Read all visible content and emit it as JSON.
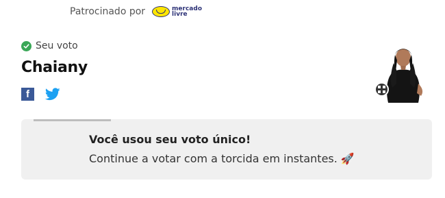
{
  "sponsor": {
    "label": "Patrocinado por",
    "brand_line1": "mercado",
    "brand_line2": "livre"
  },
  "vote": {
    "status_label": "Seu voto",
    "candidate_name": "Chaiany"
  },
  "social": {
    "facebook_icon": "f",
    "twitter_icon": "twitter-bird"
  },
  "message": {
    "title": "Você usou seu voto único!",
    "text": "Continue a votar com a torcida em instantes. 🚀"
  },
  "colors": {
    "check_green": "#3aa757",
    "facebook_blue": "#3b5998",
    "twitter_blue": "#1da1f2",
    "brand_yellow": "#ffe600",
    "panel_bg": "#f0f0f0"
  }
}
